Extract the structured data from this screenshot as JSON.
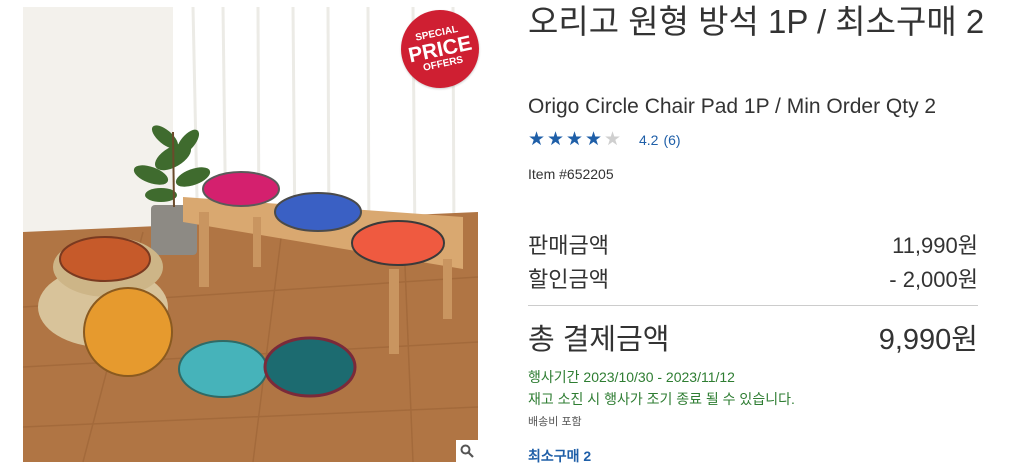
{
  "badge": {
    "line1": "SPECIAL",
    "line2": "PRICE",
    "line3": "OFFERS"
  },
  "product": {
    "title_ko": "오리고 원형 방석 1P / 최소구매 2",
    "title_en": "Origo Circle Chair Pad 1P / Min Order Qty 2",
    "rating_stars": 4.2,
    "rating_score": "4.2",
    "rating_count": "(6)",
    "item_number": "Item #652205"
  },
  "pricing": {
    "sale_label": "판매금액",
    "sale_value": "11,990원",
    "discount_label": "할인금액",
    "discount_value": "- 2,000원",
    "total_label": "총 결제금액",
    "total_value": "9,990원"
  },
  "promo": {
    "period": "행사기간 2023/10/30 - 2023/11/12",
    "note": "재고 소진 시 행사가 조기 종료 될 수 있습니다.",
    "shipping": "배송비 포함"
  },
  "min_order": "최소구매 2",
  "colors": {
    "accent_blue": "#1f5fa8",
    "promo_green": "#2e7d32",
    "badge_red": "#cf1f32"
  },
  "icons": [
    "star-icon",
    "zoom-icon"
  ]
}
